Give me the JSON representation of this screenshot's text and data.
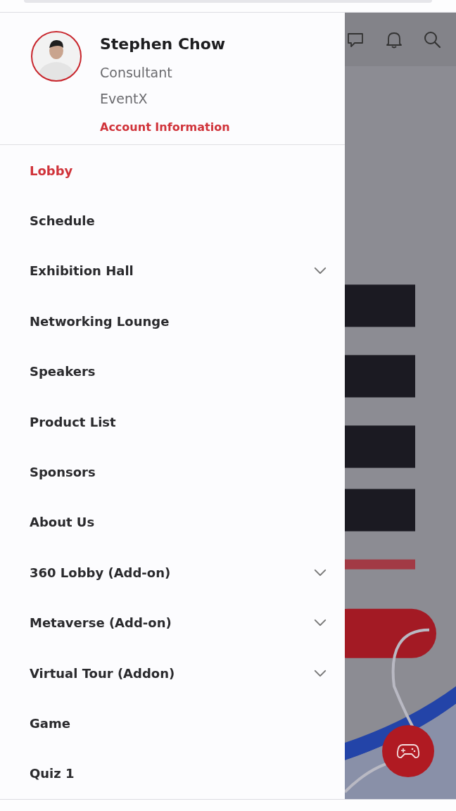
{
  "profile": {
    "name": "Stephen Chow",
    "title": "Consultant",
    "company": "EventX",
    "link": "Account Information"
  },
  "menu": [
    {
      "label": "Lobby",
      "selected": true,
      "expandable": false
    },
    {
      "label": "Schedule",
      "selected": false,
      "expandable": false
    },
    {
      "label": "Exhibition Hall",
      "selected": false,
      "expandable": true
    },
    {
      "label": "Networking Lounge",
      "selected": false,
      "expandable": false
    },
    {
      "label": "Speakers",
      "selected": false,
      "expandable": false
    },
    {
      "label": "Product List",
      "selected": false,
      "expandable": false
    },
    {
      "label": "Sponsors",
      "selected": false,
      "expandable": false
    },
    {
      "label": "About Us",
      "selected": false,
      "expandable": false
    },
    {
      "label": "360 Lobby (Add-on)",
      "selected": false,
      "expandable": true
    },
    {
      "label": "Metaverse (Add-on)",
      "selected": false,
      "expandable": true
    },
    {
      "label": "Virtual Tour (Addon)",
      "selected": false,
      "expandable": true
    },
    {
      "label": "Game",
      "selected": false,
      "expandable": false
    },
    {
      "label": "Quiz 1",
      "selected": false,
      "expandable": false
    }
  ]
}
